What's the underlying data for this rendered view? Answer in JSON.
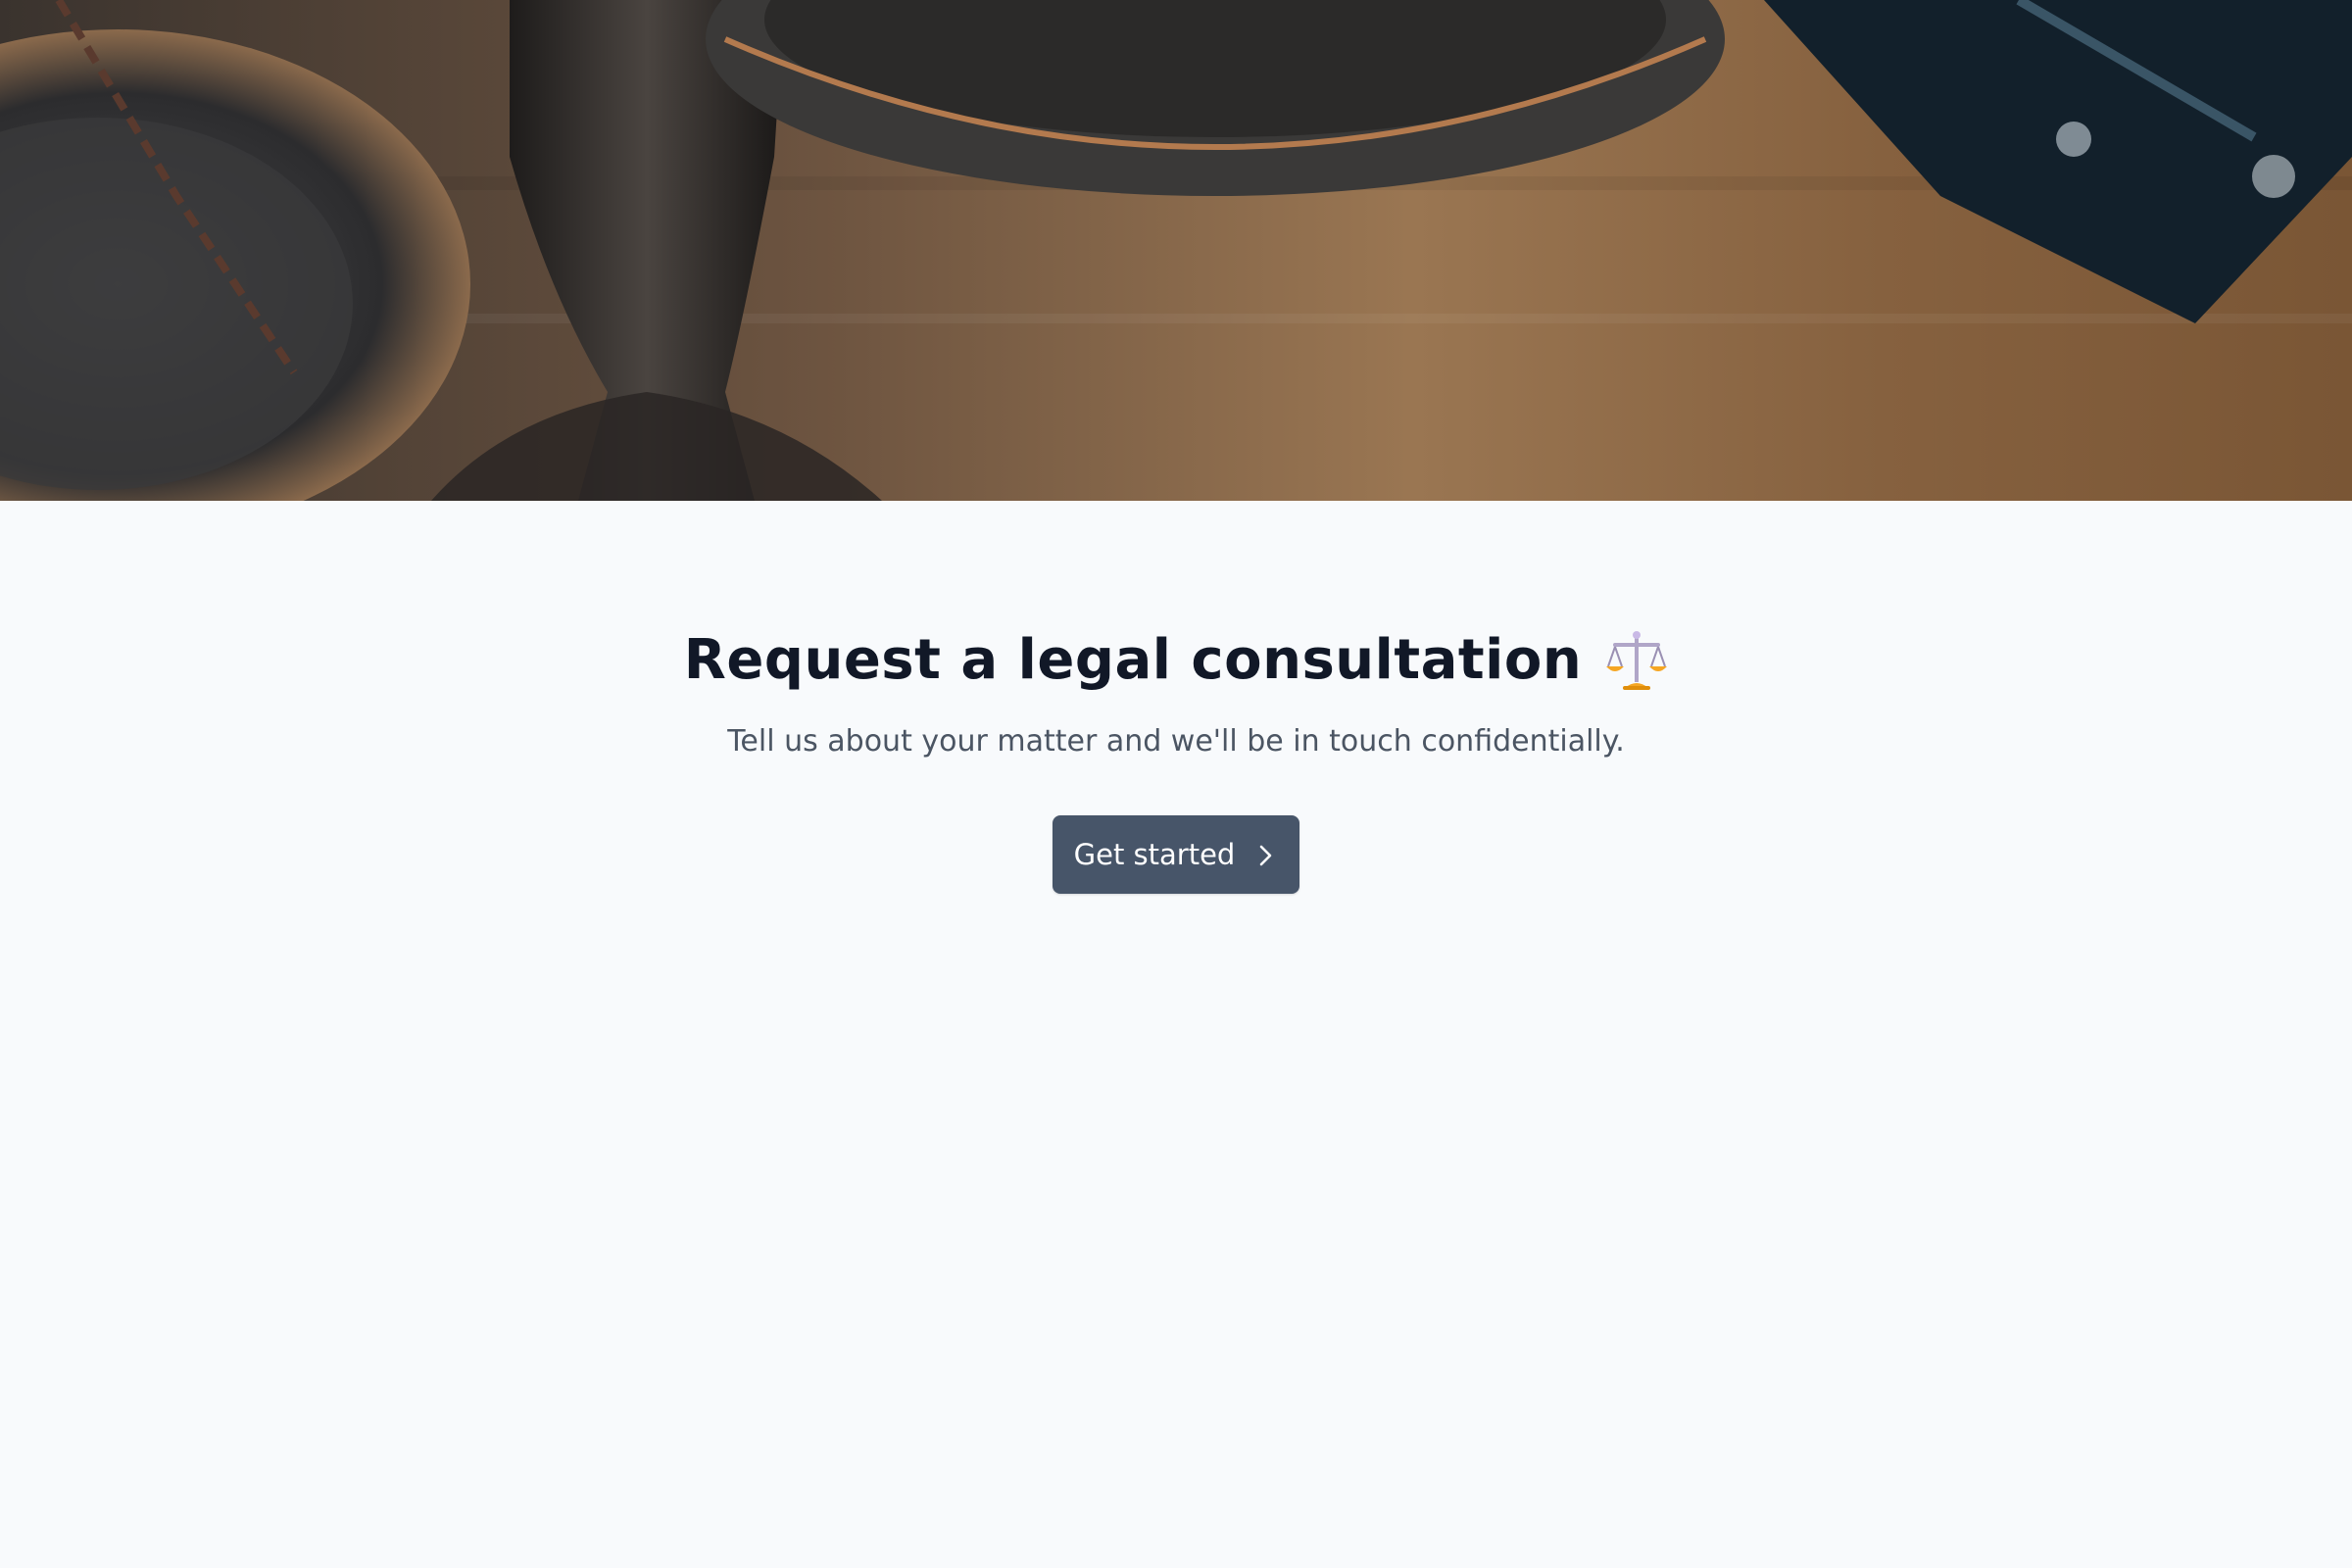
{
  "hero": {
    "image_alt_icon": "scales-photo"
  },
  "main": {
    "title": "Request a legal consultation",
    "title_icon": "balance-scale-icon",
    "subtitle": "Tell us about your matter and we'll be in touch confidentially.",
    "cta_label": "Get started",
    "cta_icon": "chevron-right-icon"
  },
  "colors": {
    "background": "#f8fafc",
    "title": "#111827",
    "subtitle": "#4b5563",
    "button": "#475569",
    "button_text": "#ffffff"
  }
}
